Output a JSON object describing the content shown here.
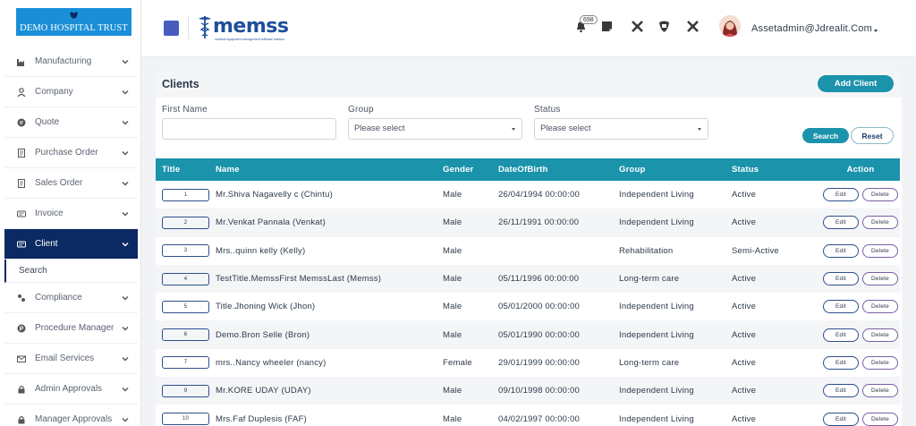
{
  "brand": {
    "name": "DEMO HOSPITAL TRUST"
  },
  "header": {
    "logo_word": "memss",
    "logo_tagline": "medical equipment management software solution",
    "notification_count": "698",
    "user_email": "Assetadmin@Jdrealit.Com"
  },
  "sidebar": {
    "items": [
      {
        "label": "Manufacturing",
        "icon": "factory-icon"
      },
      {
        "label": "Company",
        "icon": "company-icon"
      },
      {
        "label": "Quote",
        "icon": "quote-icon"
      },
      {
        "label": "Purchase Order",
        "icon": "purchase-order-icon"
      },
      {
        "label": "Sales Order",
        "icon": "sales-order-icon"
      },
      {
        "label": "Invoice",
        "icon": "invoice-icon"
      },
      {
        "label": "Client",
        "icon": "client-icon",
        "active": true
      },
      {
        "label": "Compliance",
        "icon": "compliance-icon"
      },
      {
        "label": "Procedure Manager",
        "icon": "procedure-icon"
      },
      {
        "label": "Email Services",
        "icon": "email-icon"
      },
      {
        "label": "Admin Approvals",
        "icon": "lock-icon"
      },
      {
        "label": "Manager Approvals",
        "icon": "lock-icon"
      }
    ],
    "client_submenu": [
      "Search"
    ]
  },
  "page": {
    "title": "Clients",
    "add_button": "Add Client",
    "filters": {
      "first_name_label": "First Name",
      "first_name_value": "",
      "group_label": "Group",
      "group_value": "Please select",
      "status_label": "Status",
      "status_value": "Please select"
    },
    "search_button": "Search",
    "reset_button": "Reset"
  },
  "table": {
    "columns": [
      "Title",
      "Name",
      "Gender",
      "DateOfBirth",
      "Group",
      "Status",
      "Action"
    ],
    "edit_label": "Edit",
    "delete_label": "Delete",
    "rows": [
      {
        "title": "1",
        "name": "Mr.Shiva Nagavelly c (Chintu)",
        "gender": "Male",
        "dob": "26/04/1994 00:00:00",
        "group": "Independent Living",
        "status": "Active"
      },
      {
        "title": "2",
        "name": "Mr.Venkat Pannala (Venkat)",
        "gender": "Male",
        "dob": "26/11/1991 00:00:00",
        "group": "Independent Living",
        "status": "Active"
      },
      {
        "title": "3",
        "name": "Mrs..quinn kelly (Kelly)",
        "gender": "Male",
        "dob": "",
        "group": "Rehabilitation",
        "status": "Semi-Active"
      },
      {
        "title": "4",
        "name": "TestTitle.MemssFirst MemssLast (Memss)",
        "gender": "Male",
        "dob": "05/11/1996 00:00:00",
        "group": "Long-term care",
        "status": "Active"
      },
      {
        "title": "5",
        "name": "Title.Jhoning Wick (Jhon)",
        "gender": "Male",
        "dob": "05/01/2000 00:00:00",
        "group": "Independent Living",
        "status": "Active"
      },
      {
        "title": "6",
        "name": "Demo.Bron Selle (Bron)",
        "gender": "Male",
        "dob": "05/01/1990 00:00:00",
        "group": "Independent Living",
        "status": "Active"
      },
      {
        "title": "7",
        "name": "mrs..Nancy wheeler (nancy)",
        "gender": "Female",
        "dob": "29/01/1999 00:00:00",
        "group": "Long-term care",
        "status": "Active"
      },
      {
        "title": "9",
        "name": "Mr.KORE UDAY (UDAY)",
        "gender": "Male",
        "dob": "09/10/1998 00:00:00",
        "group": "Independent Living",
        "status": "Active"
      },
      {
        "title": "10",
        "name": "Mrs.Faf Duplesis (FAF)",
        "gender": "Male",
        "dob": "04/02/1997 00:00:00",
        "group": "Independent Living",
        "status": "Active"
      }
    ]
  }
}
